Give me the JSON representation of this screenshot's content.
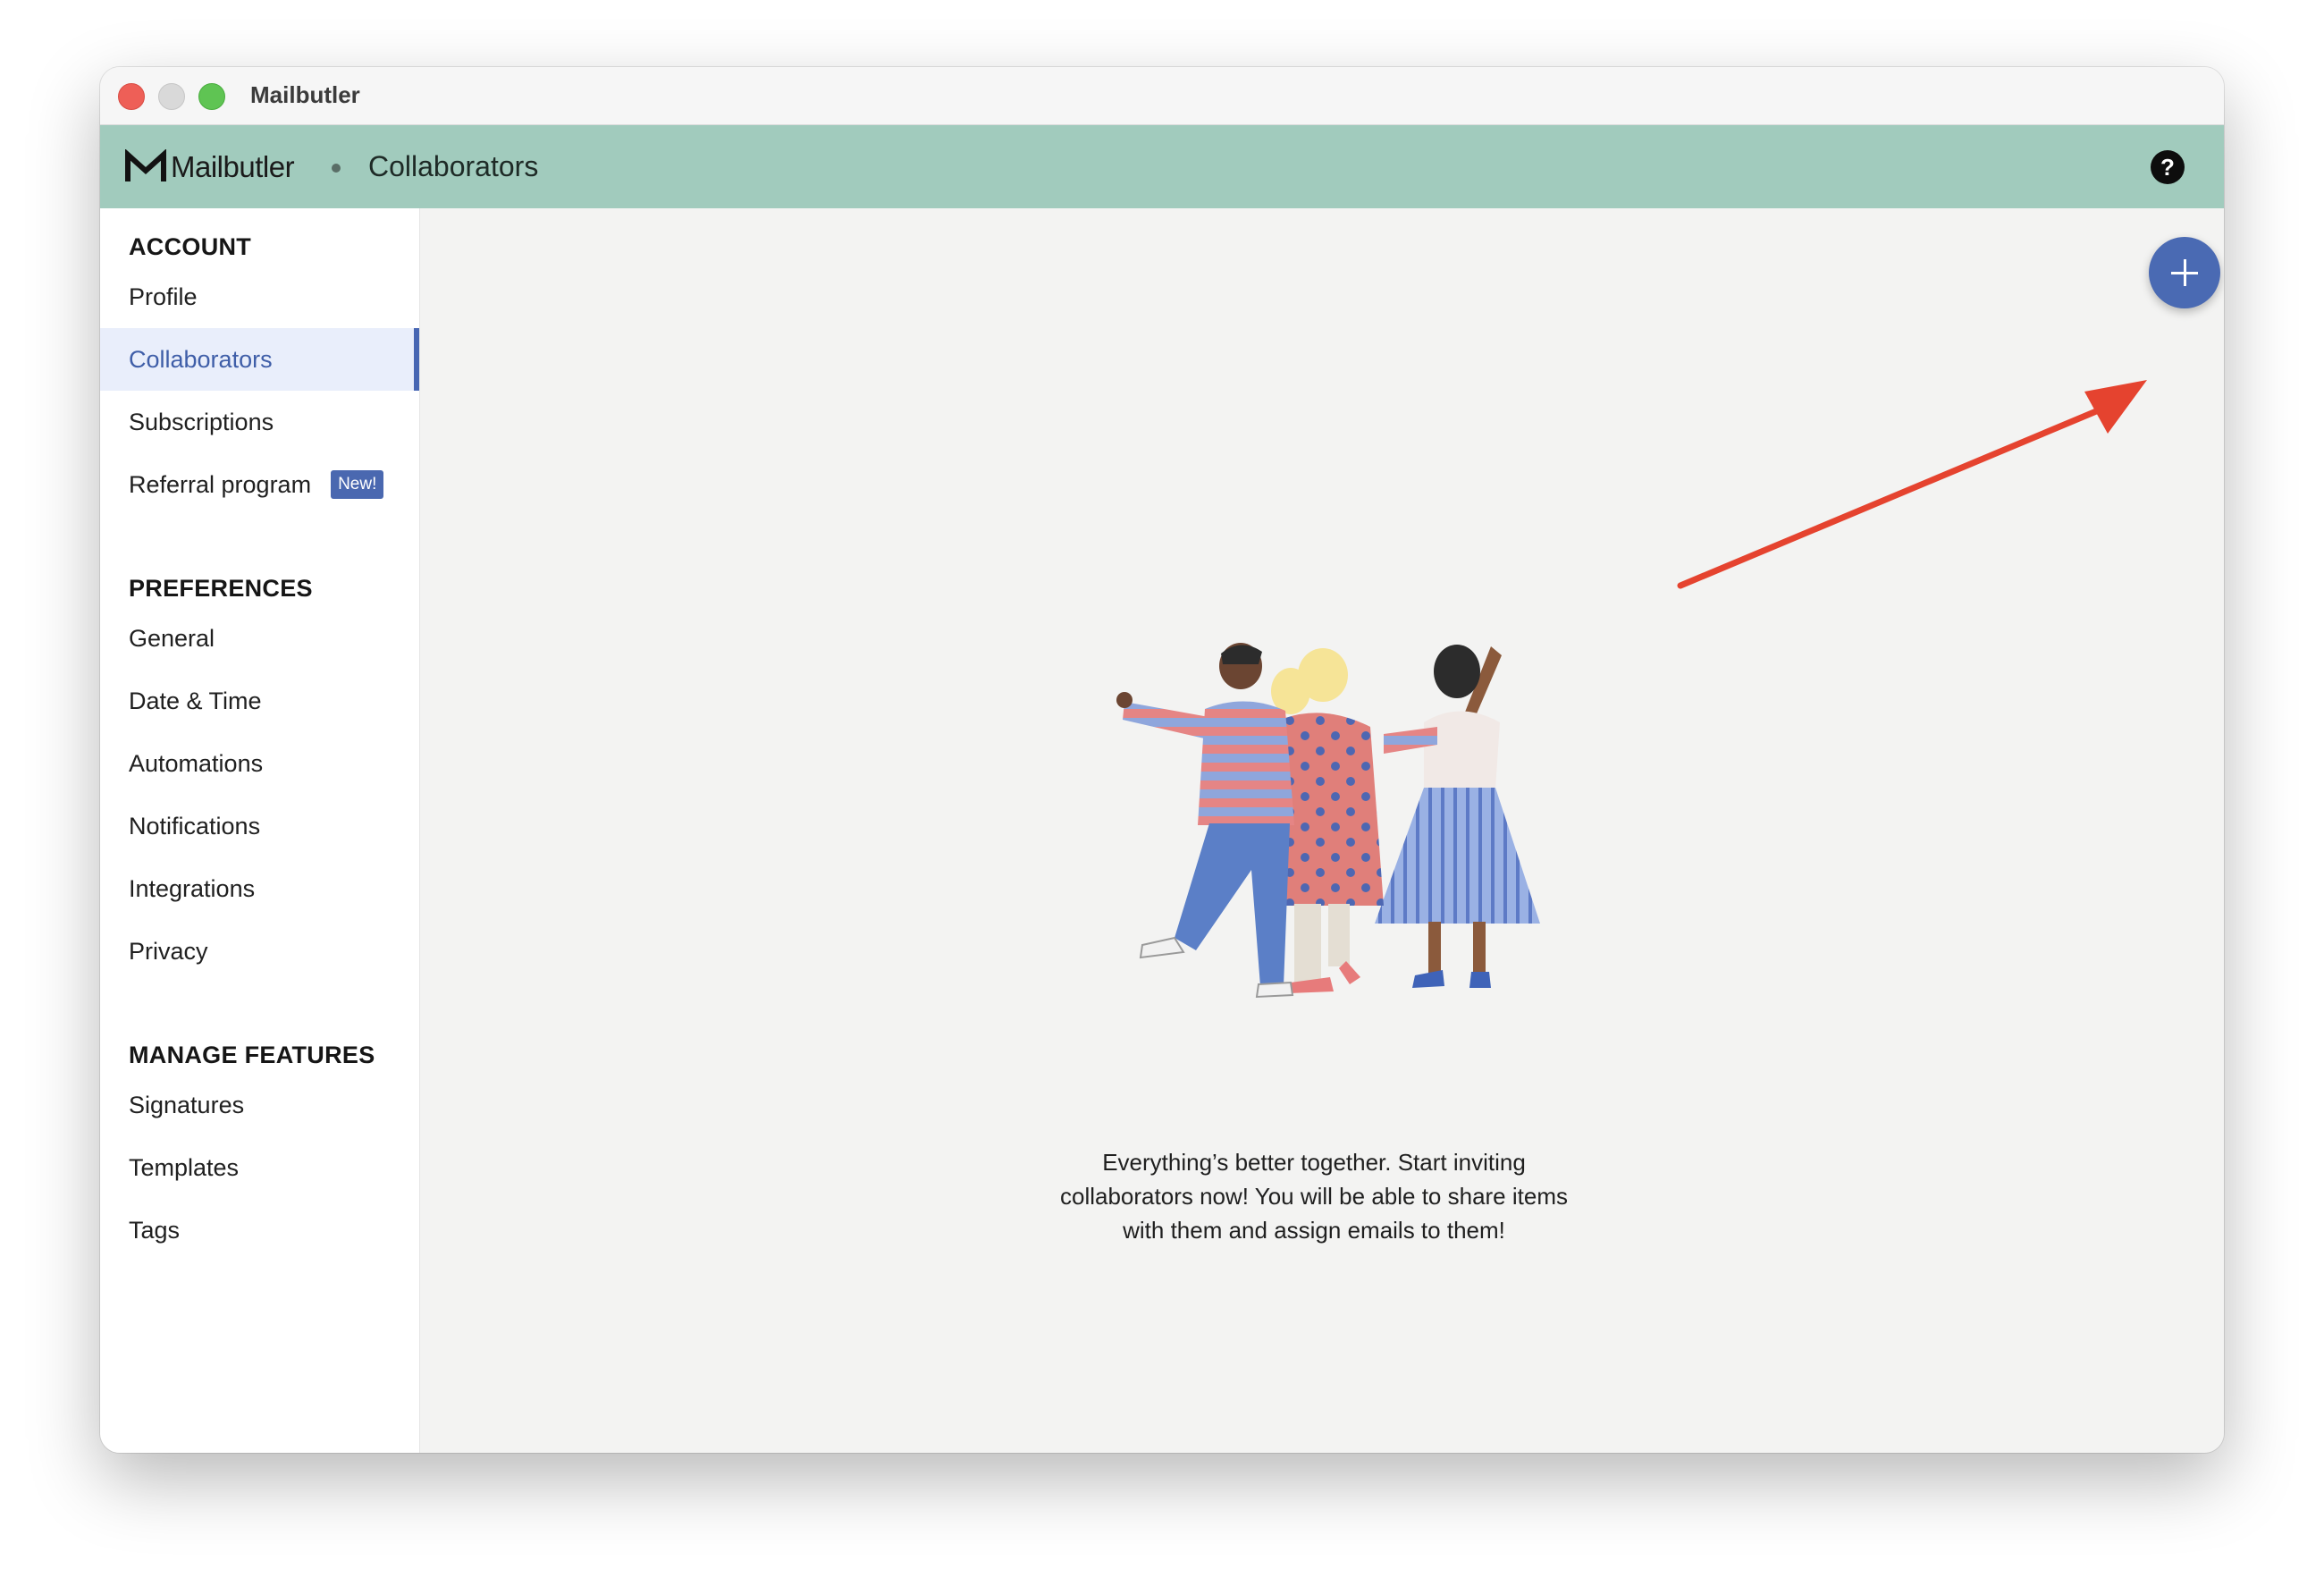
{
  "window": {
    "title": "Mailbutler"
  },
  "appbar": {
    "logo_text": "Mailbutler",
    "page_title": "Collaborators"
  },
  "sidebar": {
    "sections": [
      {
        "title": "ACCOUNT",
        "items": [
          "Profile",
          "Collaborators",
          "Subscriptions",
          "Referral program"
        ]
      },
      {
        "title": "PREFERENCES",
        "items": [
          "General",
          "Date & Time",
          "Automations",
          "Notifications",
          "Integrations",
          "Privacy"
        ]
      },
      {
        "title": "MANAGE FEATURES",
        "items": [
          "Signatures",
          "Templates",
          "Tags"
        ]
      }
    ],
    "active_item": "Collaborators",
    "new_badge": "New!"
  },
  "content": {
    "empty_state_text": "Everything’s better together. Start inviting collaborators now! You will be able to share items with them and assign emails to them!"
  },
  "colors": {
    "appbar": "#a1cbbd",
    "accent": "#4a6ab3",
    "annotation_arrow": "#e5432f"
  }
}
